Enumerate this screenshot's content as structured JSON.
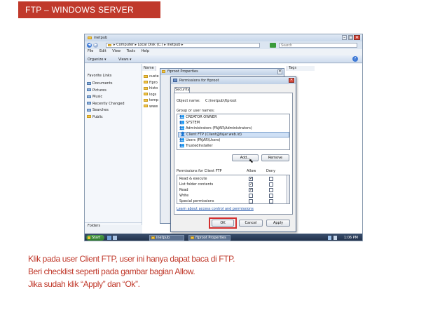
{
  "banner": {
    "title": "FTP – WINDOWS SERVER"
  },
  "explorer": {
    "window_title": "inetpub",
    "address": "▸ Computer ▸ Local Disk (C:) ▸ inetpub ▸",
    "search_placeholder": "Search",
    "menu": [
      "File",
      "Edit",
      "View",
      "Tools",
      "Help"
    ],
    "organize": "Organize ▾",
    "views": "Views ▾",
    "favorite_links_label": "Favorite Links",
    "favorites": [
      "Documents",
      "Pictures",
      "Music",
      "Recently Changed",
      "Searches",
      "Public"
    ],
    "folders_label": "Folders",
    "col_name": "Name",
    "col_tags": "Tags",
    "files": [
      "custe",
      "ftpro",
      "histo",
      "logs",
      "temp",
      "www"
    ]
  },
  "properties": {
    "title": "ftproot Properties"
  },
  "permissions": {
    "title": "Permissions for ftproot",
    "tab": "Security",
    "object_label": "Object name:",
    "object_value": "C:\\inetpub\\ftproot",
    "group_label": "Group or user names:",
    "users": [
      "CREATOR OWNER",
      "SYSTEM",
      "Administrators (FAJAR\\Administrators)",
      "Client FTP (Client@fajar.web.id)",
      "Users (FAJAR\\Users)",
      "TrustedInstaller"
    ],
    "selected_user_index": 3,
    "add_button": "Add...",
    "remove_button": "Remove",
    "perm_header": "Permissions for Client FTP",
    "allow_label": "Allow",
    "deny_label": "Deny",
    "perms": [
      "Read & execute",
      "List folder contents",
      "Read",
      "Write",
      "Special permissions"
    ],
    "allow_checked": [
      true,
      true,
      true,
      false,
      false
    ],
    "deny_checked": [
      false,
      false,
      false,
      false,
      false
    ],
    "link": "Learn about access control and permissions",
    "ok_button": "OK",
    "cancel_button": "Cancel",
    "apply_button": "Apply",
    "highlight_color": "#d32f2f"
  },
  "taskbar": {
    "start": "Start",
    "items": [
      "inetpub",
      "ftproot Properties"
    ],
    "clock": "1:06 PM"
  },
  "caption": {
    "line1": "Klik pada user Client FTP,  user ini hanya dapat baca di FTP.",
    "line2": "Beri checklist seperti pada gambar bagian Allow.",
    "line3": "Jika sudah klik “Apply” dan “Ok”."
  }
}
